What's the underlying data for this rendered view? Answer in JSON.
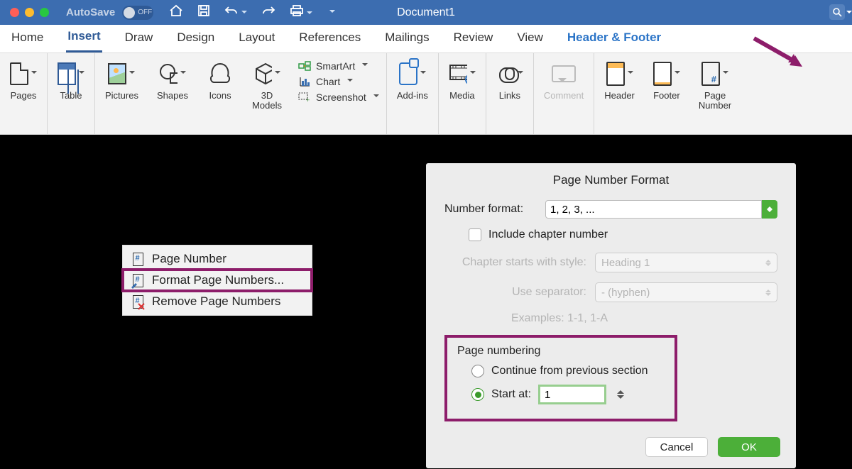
{
  "titlebar": {
    "autosave": "AutoSave",
    "toggle": "OFF",
    "docname": "Document1"
  },
  "tabs": {
    "home": "Home",
    "insert": "Insert",
    "draw": "Draw",
    "design": "Design",
    "layout": "Layout",
    "references": "References",
    "mailings": "Mailings",
    "review": "Review",
    "view": "View",
    "hf": "Header & Footer"
  },
  "ribbon": {
    "pages": "Pages",
    "table": "Table",
    "pictures": "Pictures",
    "shapes": "Shapes",
    "icons": "Icons",
    "models": "3D\nModels",
    "smartart": "SmartArt",
    "chart": "Chart",
    "screenshot": "Screenshot",
    "addins": "Add-ins",
    "media": "Media",
    "links": "Links",
    "comment": "Comment",
    "header": "Header",
    "footer": "Footer",
    "pagenum": "Page\nNumber"
  },
  "menu": {
    "pn": "Page Number",
    "fpn": "Format Page Numbers...",
    "rpn": "Remove Page Numbers"
  },
  "dialog": {
    "title": "Page Number Format",
    "numfmt_label": "Number format:",
    "numfmt_value": "1, 2, 3, ...",
    "include": "Include chapter number",
    "chapstyle_label": "Chapter starts with style:",
    "chapstyle_value": "Heading 1",
    "sep_label": "Use separator:",
    "sep_value": "-     (hyphen)",
    "examples": "Examples:  1-1, 1-A",
    "section": "Page numbering",
    "cont": "Continue from previous section",
    "start": "Start at:",
    "start_value": "1",
    "cancel": "Cancel",
    "ok": "OK"
  }
}
